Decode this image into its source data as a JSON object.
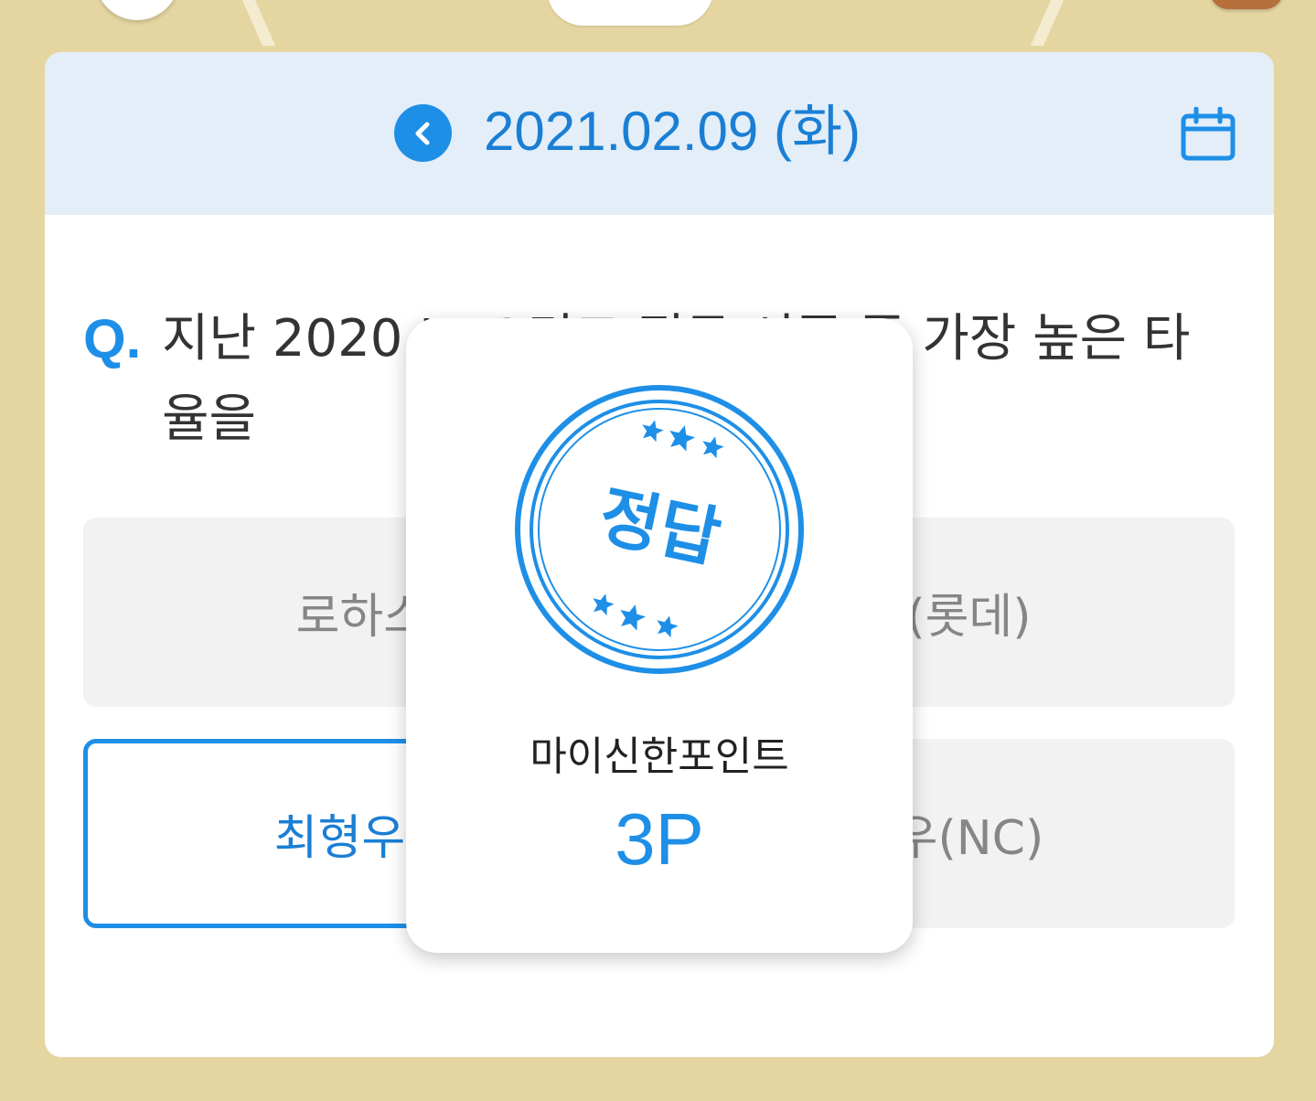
{
  "colors": {
    "background": "#e5d6a1",
    "header": "#e3eef8",
    "accent": "#1e8fe7",
    "option_bg": "#f2f2f2"
  },
  "header": {
    "date": "2021.02.09 (화)",
    "prev_icon": "chevron-left-icon",
    "calendar_icon": "calendar-icon"
  },
  "question": {
    "mark": "Q.",
    "text": "지난 2020 KBO리그 정규 시즌 중 가장 높은 타율을"
  },
  "options": [
    {
      "label": "로하스("
    },
    {
      "label": "섭(롯데)"
    },
    {
      "label": "최형우(기"
    },
    {
      "label": "민우(NC)"
    }
  ],
  "result": {
    "stamp_text": "정답",
    "point_label": "마이신한포인트",
    "point_value": "3P"
  }
}
